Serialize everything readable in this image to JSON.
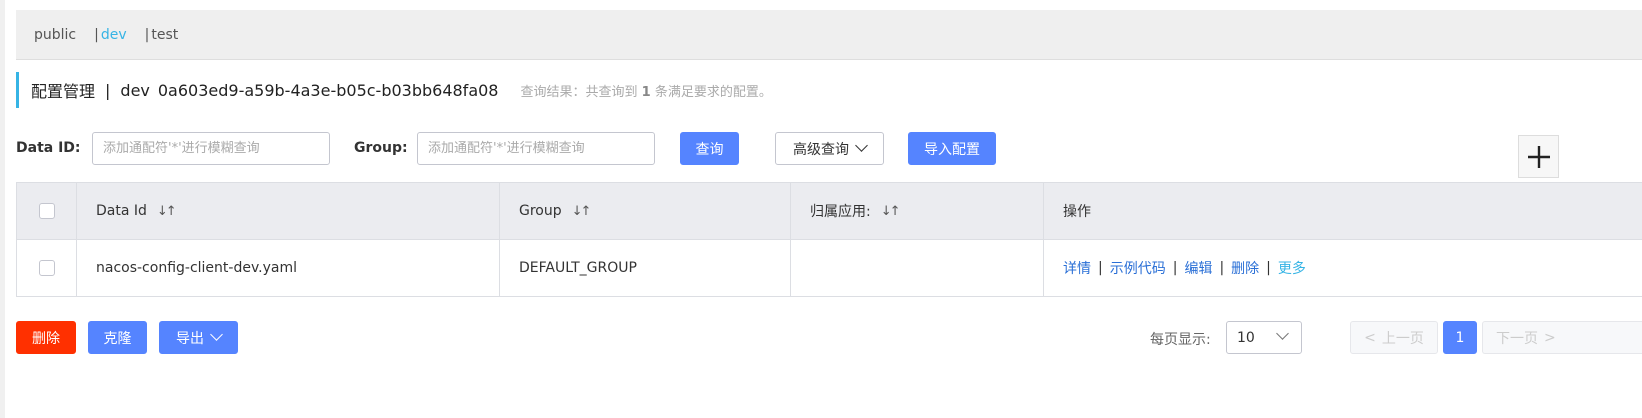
{
  "namespaces": {
    "items": [
      {
        "label": "public"
      },
      {
        "label": "dev"
      },
      {
        "label": "test"
      }
    ],
    "separator": "|",
    "active": "dev"
  },
  "header": {
    "title": "配置管理",
    "separator": "|",
    "namespace_name": "dev",
    "namespace_id": "0a603ed9-a59b-4a3e-b05c-b03bb648fa08",
    "result_prefix": "查询结果：共查询到",
    "result_count": "1",
    "result_suffix": "条满足要求的配置。"
  },
  "filters": {
    "data_id_label": "Data ID:",
    "data_id_placeholder": "添加通配符'*'进行模糊查询",
    "group_label": "Group:",
    "group_placeholder": "添加通配符'*'进行模糊查询",
    "search_button": "查询",
    "advanced_button": "高级查询",
    "import_button": "导入配置"
  },
  "table": {
    "columns": [
      "Data Id",
      "Group",
      "归属应用:",
      "操作"
    ],
    "sort_glyph": "↓↑",
    "rows": [
      {
        "data_id": "nacos-config-client-dev.yaml",
        "group": "DEFAULT_GROUP",
        "app": "",
        "actions": [
          "详情",
          "示例代码",
          "编辑",
          "删除",
          "更多"
        ]
      }
    ],
    "action_separator": "|"
  },
  "bulk_actions": {
    "delete": "删除",
    "clone": "克隆",
    "export": "导出"
  },
  "pagination": {
    "page_size_label": "每页显示:",
    "page_size": "10",
    "prev": "上一页",
    "current_page": "1",
    "next": "下一页"
  },
  "colors": {
    "primary": "#5584ff",
    "danger": "#ff3000",
    "accent": "#36b4e5",
    "link": "#2a6fd6"
  },
  "icons": [
    "sort-icon",
    "chevron-down-icon",
    "plus-icon",
    "chevron-left-icon",
    "chevron-right-icon",
    "checkbox-icon"
  ]
}
